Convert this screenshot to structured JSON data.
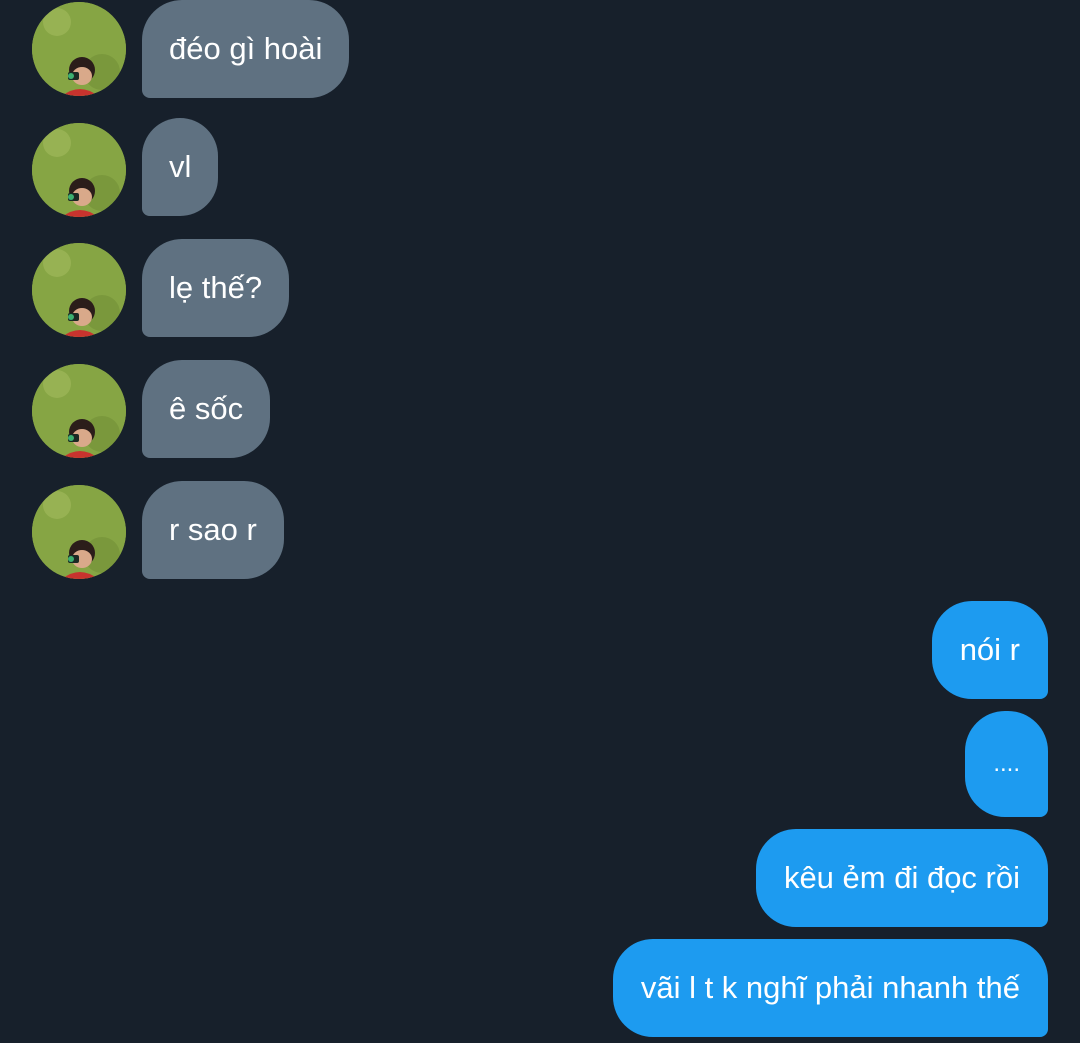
{
  "incoming": [
    {
      "text": "đéo gì hoài"
    },
    {
      "text": "vl"
    },
    {
      "text": "lẹ thế?"
    },
    {
      "text": "ê sốc"
    },
    {
      "text": "r sao r"
    }
  ],
  "outgoing": [
    {
      "text": "nói r"
    },
    {
      "text": "...."
    },
    {
      "text": "kêu ẻm đi đọc rồi"
    },
    {
      "text": "vãi l t k nghĩ phải nhanh thế"
    }
  ],
  "colors": {
    "background": "#17202b",
    "incoming_bubble": "#5f7181",
    "outgoing_bubble": "#1d9bf0",
    "text": "#ffffff"
  },
  "avatar_icon": "user-photo-avatar"
}
